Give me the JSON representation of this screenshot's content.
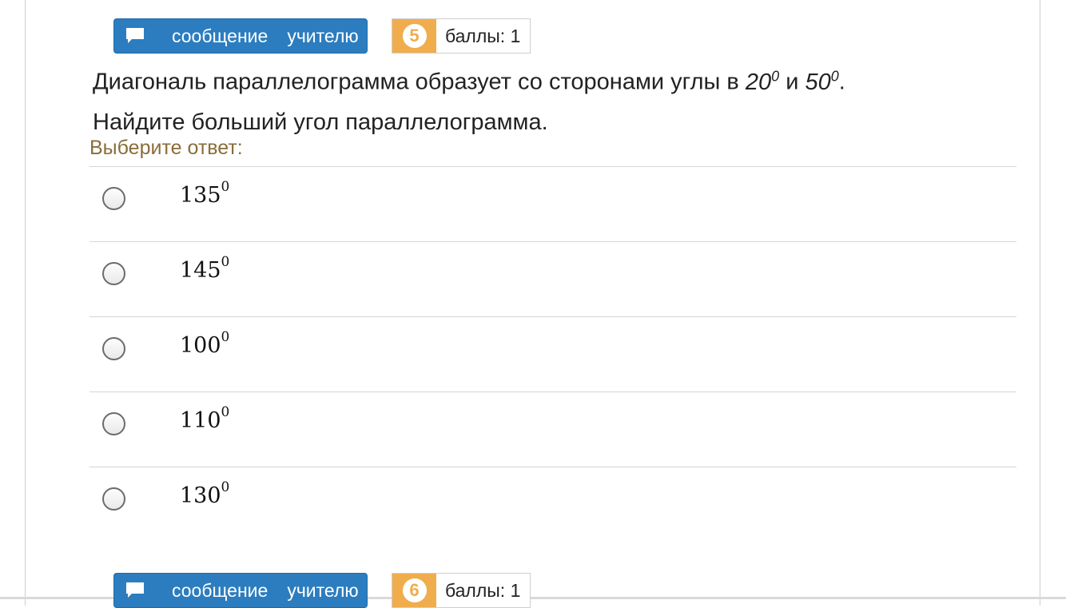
{
  "questions": [
    {
      "message_button": {
        "word1": "сообщение",
        "word2": "учителю"
      },
      "number": "5",
      "points_label": "баллы: 1"
    },
    {
      "message_button": {
        "word1": "сообщение",
        "word2": "учителю"
      },
      "number": "6",
      "points_label": "баллы: 1"
    }
  ],
  "question_text": {
    "part1": "Диагональ параллелограмма образует со сторонами углы в ",
    "angle1": "20",
    "exp1": "0",
    "part2": " и ",
    "angle2": "50",
    "exp2": "0",
    "part3": ". Найдите больший угол параллелограмма."
  },
  "choose_label": "Выберите ответ:",
  "answers": [
    {
      "value": "135",
      "exp": "0"
    },
    {
      "value": "145",
      "exp": "0"
    },
    {
      "value": "100",
      "exp": "0"
    },
    {
      "value": "110",
      "exp": "0"
    },
    {
      "value": "130",
      "exp": "0"
    }
  ],
  "colors": {
    "message_button_bg": "#2c7dbf",
    "score_badge_bg": "#f0ad4e",
    "choose_label": "#8a6d3b"
  },
  "icons": {
    "message_button": "speech-bubble-icon",
    "answer_control": "radio-button"
  }
}
